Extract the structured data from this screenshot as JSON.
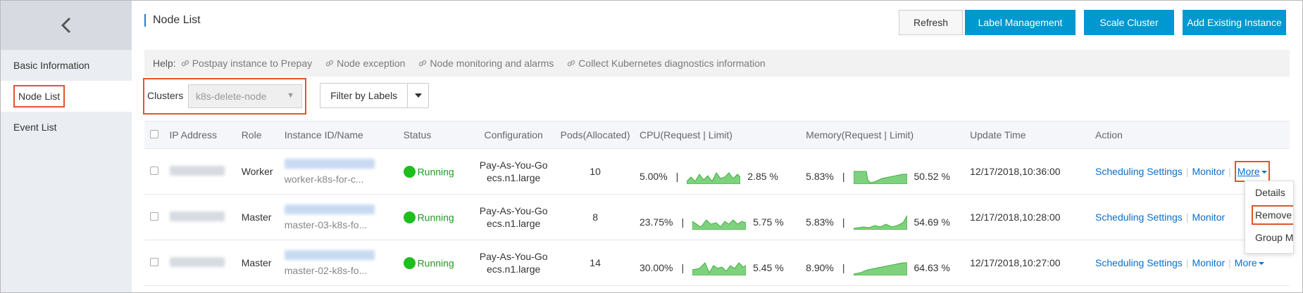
{
  "sidebar": {
    "back_icon": "chevron-left-icon",
    "items": [
      {
        "label": "Basic Information",
        "active": false
      },
      {
        "label": "Node List",
        "active": true
      },
      {
        "label": "Event List",
        "active": false
      }
    ]
  },
  "header": {
    "title": "Node List",
    "buttons": {
      "refresh": "Refresh",
      "label_management": "Label Management",
      "scale_cluster": "Scale Cluster",
      "add_existing_instance": "Add Existing Instance"
    }
  },
  "help": {
    "prefix": "Help:",
    "links": [
      "Postpay instance to Prepay",
      "Node exception",
      "Node monitoring and alarms",
      "Collect Kubernetes diagnostics information"
    ]
  },
  "filters": {
    "clusters_label": "Clusters",
    "cluster_value": "k8s-delete-node",
    "label_filter": "Filter by Labels"
  },
  "table": {
    "columns": [
      "IP Address",
      "Role",
      "Instance ID/Name",
      "Status",
      "Configuration",
      "Pods(Allocated)",
      "CPU(Request | Limit)",
      "Memory(Request | Limit)",
      "Update Time",
      "Action"
    ],
    "rows": [
      {
        "role": "Worker",
        "instance_name": "worker-k8s-for-c...",
        "status": "Running",
        "billing": "Pay-As-You-Go",
        "instance_type": "ecs.n1.large",
        "pods": "10",
        "cpu_request": "5.00%",
        "cpu_limit": "2.85 %",
        "memory_request": "5.83%",
        "memory_limit": "50.52 %",
        "update_time": "12/17/2018,10:36:00",
        "action_scheduling": "Scheduling Settings",
        "action_monitor": "Monitor",
        "action_more": "More"
      },
      {
        "role": "Master",
        "instance_name": "master-03-k8s-fo...",
        "status": "Running",
        "billing": "Pay-As-You-Go",
        "instance_type": "ecs.n1.large",
        "pods": "8",
        "cpu_request": "23.75%",
        "cpu_limit": "5.75 %",
        "memory_request": "5.83%",
        "memory_limit": "54.69 %",
        "update_time": "12/17/2018,10:28:00",
        "action_scheduling": "Scheduling Settings",
        "action_monitor": "Monitor",
        "action_more": ""
      },
      {
        "role": "Master",
        "instance_name": "master-02-k8s-fo...",
        "status": "Running",
        "billing": "Pay-As-You-Go",
        "instance_type": "ecs.n1.large",
        "pods": "14",
        "cpu_request": "30.00%",
        "cpu_limit": "5.45 %",
        "memory_request": "8.90%",
        "memory_limit": "64.63 %",
        "update_time": "12/17/2018,10:27:00",
        "action_scheduling": "Scheduling Settings",
        "action_monitor": "Monitor",
        "action_more": "More"
      }
    ]
  },
  "more_dropdown": {
    "items": [
      "Details",
      "Remove",
      "Group Mon"
    ]
  },
  "colors": {
    "primary": "#0098d0",
    "link": "#0b6ec8",
    "running": "#1fbe1f",
    "highlight": "#e4532d",
    "spark_fill": "#7ed27e"
  }
}
